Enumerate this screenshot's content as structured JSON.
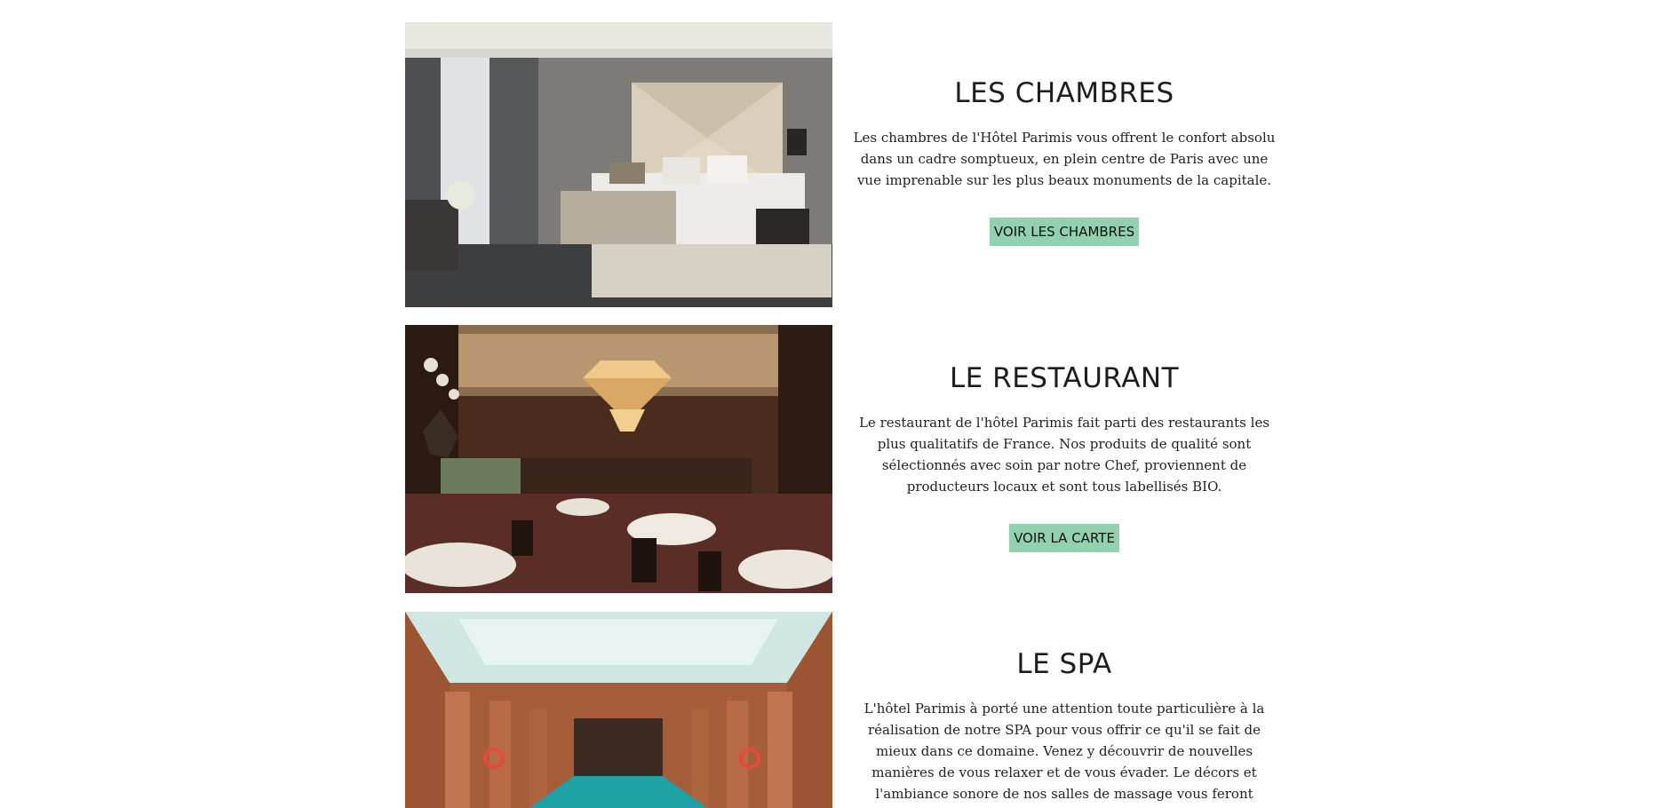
{
  "sections": [
    {
      "title": "LES CHAMBRES",
      "description": "Les chambres de l'Hôtel Parimis vous offrent le confort absolu dans un cadre somptueux, en plein centre de Paris avec une vue imprenable sur les plus beaux monuments de la capitale.",
      "button_label": "VOIR LES CHAMBRES",
      "image_subject": "hotel-bedroom"
    },
    {
      "title": "LE RESTAURANT",
      "description": "Le restaurant de l'hôtel Parimis fait parti des restaurants les plus qualitatifs de France. Nos produits de qualité sont sélectionnés avec soin par notre Chef, proviennent de producteurs locaux et sont tous labellisés BIO.",
      "button_label": "VOIR LA CARTE",
      "image_subject": "restaurant-dining-room"
    },
    {
      "title": "LE SPA",
      "description": "L'hôtel Parimis à porté une attention toute particulière à la réalisation de notre SPA pour vous offrir ce qu'il se fait de mieux dans ce domaine. Venez y découvrir de nouvelles manières de vous relaxer et de vous évader. Le décors et l'ambiance sonore de nos salles de massage vous feront voyager à coup sûr.",
      "image_subject": "indoor-spa-pool"
    }
  ],
  "colors": {
    "button_background": "#91d1ad",
    "text": "#1f1f1f",
    "page_background": "#ffffff"
  }
}
